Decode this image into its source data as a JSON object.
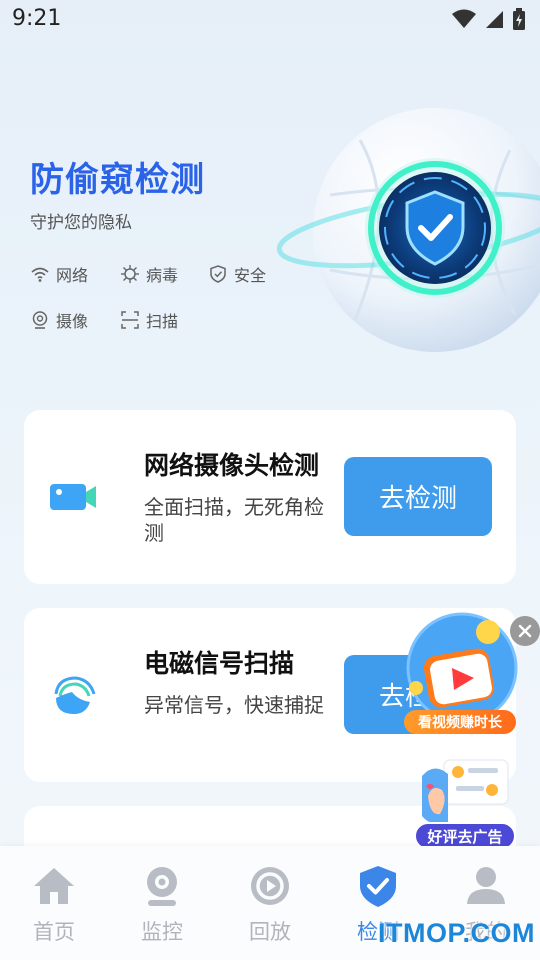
{
  "status_bar": {
    "time": "9:21"
  },
  "hero": {
    "title": "防偷窥检测",
    "subtitle": "守护您的隐私",
    "tags": [
      {
        "label": "网络",
        "icon": "wifi-icon"
      },
      {
        "label": "病毒",
        "icon": "virus-icon"
      },
      {
        "label": "安全",
        "icon": "shield-icon"
      },
      {
        "label": "摄像",
        "icon": "webcam-icon"
      },
      {
        "label": "扫描",
        "icon": "scan-icon"
      }
    ]
  },
  "cards": [
    {
      "title": "网络摄像头检测",
      "desc": "全面扫描，无死角检测",
      "button": "去检测",
      "icon": "video-camera-icon"
    },
    {
      "title": "电磁信号扫描",
      "desc": "异常信号，快速捕捉",
      "button": "去检测",
      "icon": "signal-icon"
    }
  ],
  "floating": {
    "video_ad_label": "看视频赚时长",
    "review_label": "好评去广告"
  },
  "bottom_nav": {
    "items": [
      {
        "label": "首页",
        "icon": "home-icon"
      },
      {
        "label": "监控",
        "icon": "monitor-camera-icon"
      },
      {
        "label": "回放",
        "icon": "replay-icon"
      },
      {
        "label": "检测",
        "icon": "shield-check-icon",
        "active": true
      },
      {
        "label": "我的",
        "icon": "profile-icon"
      }
    ]
  },
  "watermark": "ITMOP.COM",
  "colors": {
    "accent": "#2b63e8",
    "button": "#3f9bec",
    "nav_active": "#3b86e8",
    "nav_inactive": "#b0b4bb"
  }
}
